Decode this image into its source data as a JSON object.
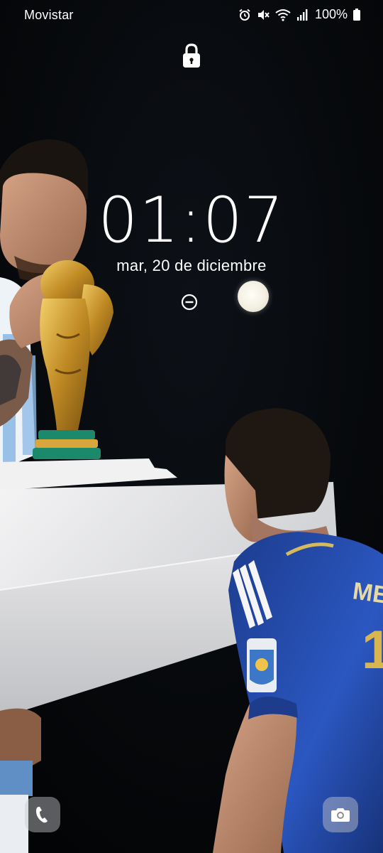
{
  "status_bar": {
    "carrier": "Movistar",
    "battery_percent": "100%",
    "icons": [
      "alarm-icon",
      "mute-icon",
      "wifi-icon",
      "signal-icon",
      "battery-icon"
    ]
  },
  "lock_screen": {
    "lock_icon": "lock-icon",
    "time": "01:07",
    "date": "mar, 20 de diciembre",
    "indicators": [
      "do-not-disturb-icon",
      "moon-icon"
    ]
  },
  "shortcuts": {
    "left": "phone-icon",
    "right": "camera-icon"
  },
  "wallpaper": {
    "description_icon": "wallpaper-image",
    "jersey_text": "MESS",
    "jersey_number": "1"
  },
  "colors": {
    "background": "#050608",
    "text": "#ffffff",
    "jersey_blue": "#2a4fb0",
    "trophy_gold": "#c9962e",
    "pedestal": "#e9e9ea"
  }
}
